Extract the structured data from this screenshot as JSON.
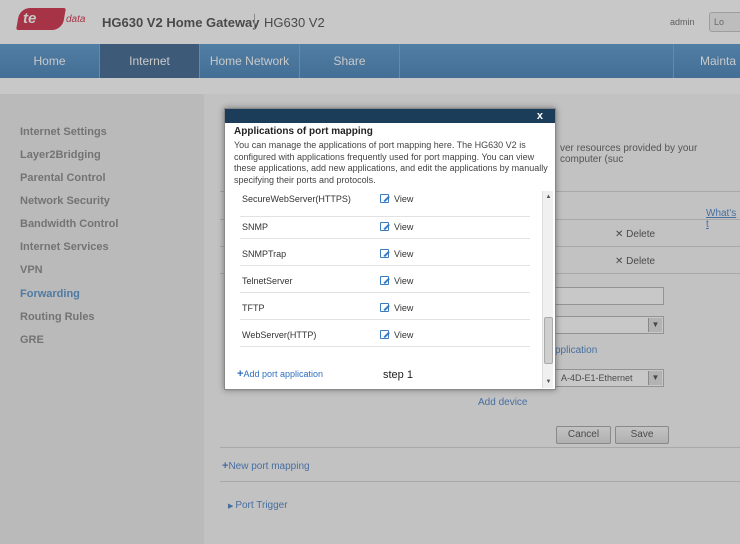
{
  "header": {
    "logo_text": "te",
    "logo_sub": "data",
    "title": "HG630 V2 Home Gateway",
    "model": "HG630 V2",
    "user": "admin",
    "logout_label": "Lo"
  },
  "nav": {
    "items": [
      "Home",
      "Internet",
      "Home Network",
      "Share",
      "Mainta"
    ],
    "active": "Internet"
  },
  "sidebar": {
    "items": [
      "Internet Settings",
      "Layer2Bridging",
      "Parental Control",
      "Network Security",
      "Bandwidth Control",
      "Internet Services",
      "VPN",
      "Forwarding",
      "Routing Rules",
      "GRE"
    ],
    "active": "Forwarding"
  },
  "background": {
    "desc_fragment": "ver resources provided by your computer (suc",
    "whats_this": "What's t",
    "delete_label": "Delete",
    "app_link_fragment": "pplication",
    "device_select": "A-4D-E1-Ethernet",
    "add_device": "Add device",
    "cancel_label": "Cancel",
    "save_label": "Save",
    "new_port_mapping": "New port mapping",
    "port_trigger": "Port Trigger"
  },
  "modal": {
    "close": "x",
    "heading": "Applications of port mapping",
    "description": "You can manage the applications of port mapping here. The HG630 V2 is configured with applications frequently used for port mapping. You can view these applications, add new applications, and edit the applications by manually specifying their ports and protocols.",
    "view_label": "View",
    "applications": [
      "SecureWebServer(HTTPS)",
      "SNMP",
      "SNMPTrap",
      "TelnetServer",
      "TFTP",
      "WebServer(HTTP)"
    ],
    "add_label": "Add port application",
    "step_label": "step 1"
  },
  "colors": {
    "brand_red": "#c8102e",
    "nav_blue": "#2a6fae",
    "link_blue": "#2f6fbf"
  }
}
